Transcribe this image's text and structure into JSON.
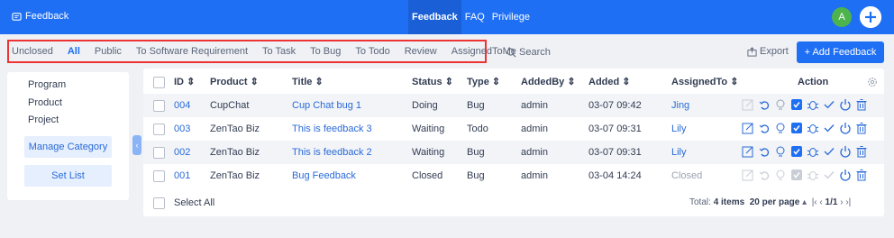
{
  "app": {
    "brand": "Feedback",
    "nav": [
      "Feedback",
      "FAQ",
      "Privilege"
    ],
    "avatar_letter": "A"
  },
  "toolbar": {
    "filters": [
      "Unclosed",
      "All",
      "Public",
      "To Software Requirement",
      "To Task",
      "To Bug",
      "To Todo",
      "Review",
      "AssignedToMe"
    ],
    "active_filter": "All",
    "search_label": "Search",
    "export_label": "Export",
    "add_label": "+ Add Feedback"
  },
  "sidebar": {
    "links": [
      "Program",
      "Product",
      "Project"
    ],
    "manage_label": "Manage Category",
    "setlist_label": "Set List"
  },
  "table": {
    "columns": [
      "ID",
      "Product",
      "Title",
      "Status",
      "Type",
      "AddedBy",
      "Added",
      "AssignedTo",
      "Action"
    ],
    "rows": [
      {
        "id": "004",
        "product": "CupChat",
        "title": "Cup Chat bug 1",
        "status": "Doing",
        "type": "Bug",
        "addedby": "admin",
        "added": "03-07 09:42",
        "assignedto": "Jing"
      },
      {
        "id": "003",
        "product": "ZenTao Biz",
        "title": "This is feedback 3",
        "status": "Waiting",
        "type": "Todo",
        "addedby": "admin",
        "added": "03-07 09:31",
        "assignedto": "Lily"
      },
      {
        "id": "002",
        "product": "ZenTao Biz",
        "title": "This is feedback 2",
        "status": "Waiting",
        "type": "Bug",
        "addedby": "admin",
        "added": "03-07 09:31",
        "assignedto": "Lily"
      },
      {
        "id": "001",
        "product": "ZenTao Biz",
        "title": "Bug Feedback",
        "status": "Closed",
        "type": "Bug",
        "addedby": "admin",
        "added": "03-04 14:24",
        "assignedto": "Closed"
      }
    ],
    "select_all": "Select All"
  },
  "pager": {
    "total_prefix": "Total:",
    "total_count": "4 items",
    "per_page": "20 per page",
    "page": "1/1"
  },
  "colors": {
    "primary": "#1e6ff4",
    "highlight_box": "#ee3333",
    "avatar": "#4db34d"
  }
}
